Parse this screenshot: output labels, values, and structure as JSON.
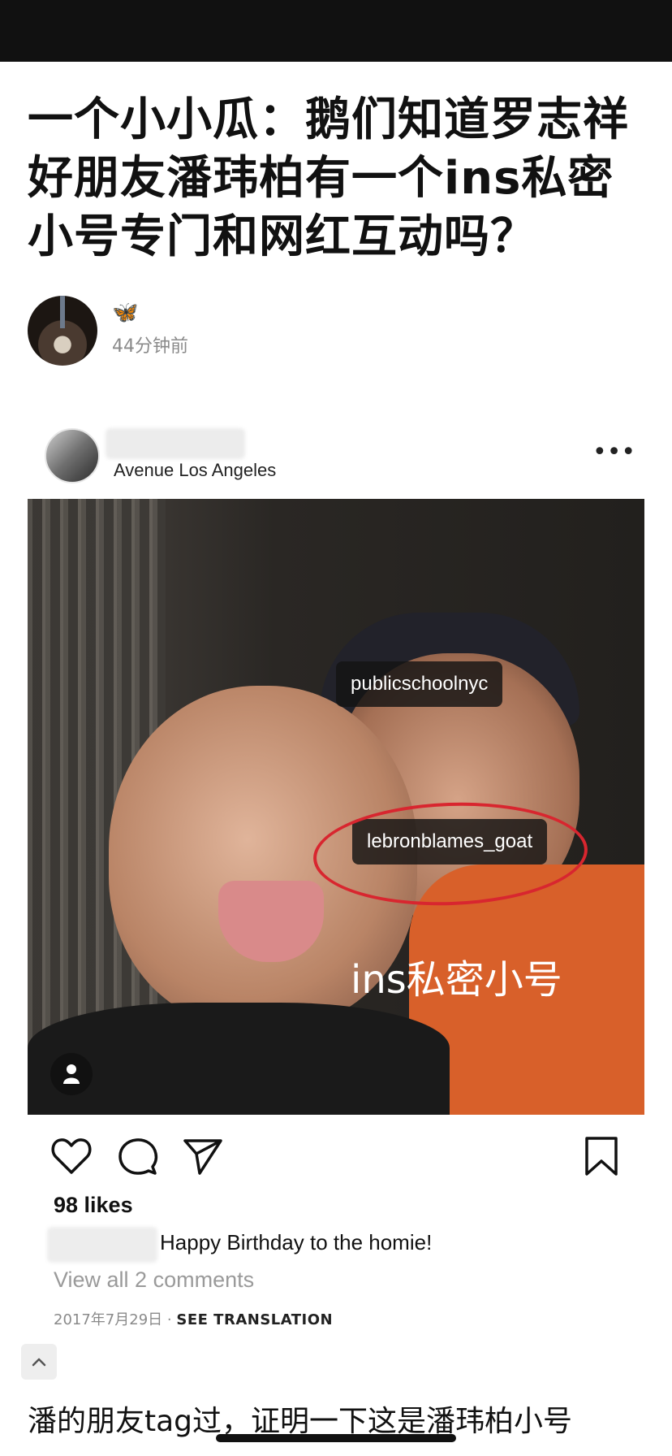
{
  "article": {
    "title": "一个小小瓜：鹅们知道罗志祥好朋友潘玮柏有一个ins私密小号专门和网红互动吗？",
    "author_badge": "🦋",
    "time": "44分钟前"
  },
  "instagram": {
    "location": "Avenue Los Angeles",
    "more_icon": "more-icon",
    "tags": [
      "publicschoolnyc",
      "lebronblames_goat"
    ],
    "overlay_text": "ins私密小号",
    "likes": "98 likes",
    "caption": "Happy Birthday to the homie!",
    "view_comments": "View all 2 comments",
    "date": "2017年7月29日",
    "see_translation": "SEE TRANSLATION",
    "icons": [
      "heart-icon",
      "comment-icon",
      "share-icon",
      "bookmark-icon"
    ]
  },
  "footer": {
    "text": "潘的朋友tag过，证明一下这是潘玮柏小号"
  },
  "colors": {
    "top_bar": "#111111",
    "highlight_circle": "#d8262f"
  }
}
